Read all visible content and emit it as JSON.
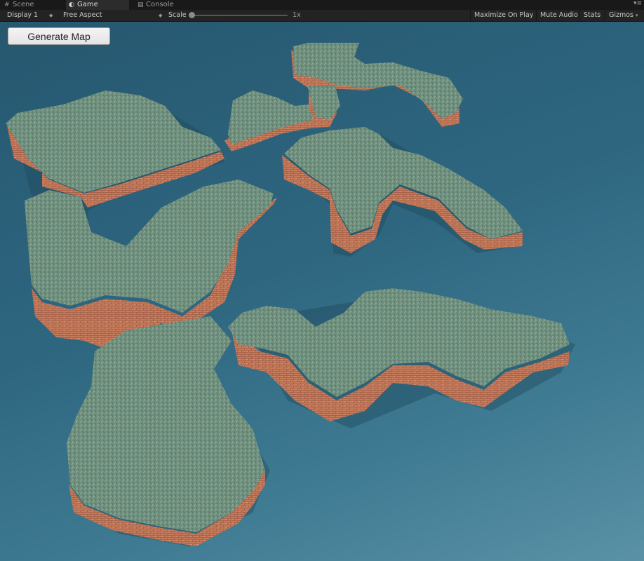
{
  "tabs": [
    {
      "label": "Scene",
      "icon": "scene-grid-icon",
      "active": false
    },
    {
      "label": "Game",
      "icon": "game-controller-icon",
      "active": true
    },
    {
      "label": "Console",
      "icon": "console-icon",
      "active": false
    }
  ],
  "toolbar": {
    "display": "Display 1",
    "aspect": "Free Aspect",
    "scale_label": "Scale",
    "scale_value": "1x",
    "maximize": "Maximize On Play",
    "mute": "Mute Audio",
    "stats": "Stats",
    "gizmos": "Gizmos"
  },
  "game": {
    "generate_button": "Generate Map"
  },
  "colors": {
    "water": "#2e6680",
    "grass": "#6f8f7e",
    "brick": "#c77e5e"
  }
}
